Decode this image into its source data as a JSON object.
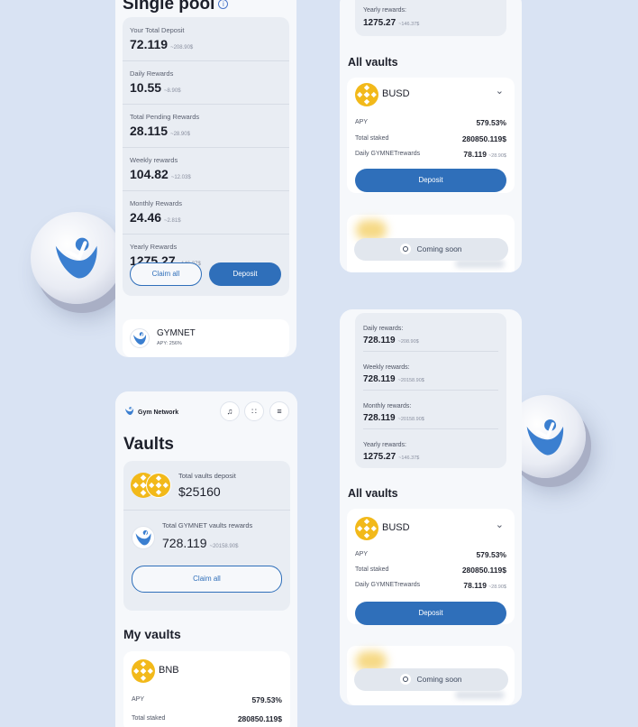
{
  "single_pool": {
    "title": "Single pool",
    "info_icon": "i",
    "stats": [
      {
        "label": "Your Total Deposit",
        "value": "72.119",
        "usd": "~208.90$"
      },
      {
        "label": "Daily Rewards",
        "value": "10.55",
        "usd": "~8.90$"
      },
      {
        "label": "Total Pending Rewards",
        "value": "28.115",
        "usd": "~28.90$"
      },
      {
        "label": "Weekly rewards",
        "value": "104.82",
        "usd": "~12.03$"
      },
      {
        "label": "Monthly Rewards",
        "value": "24.46",
        "usd": "~2.81$"
      },
      {
        "label": "Yearly Rewards",
        "value": "1275.27",
        "usd": "~146.37$"
      }
    ],
    "claim_label": "Claim all",
    "deposit_label": "Deposit",
    "pool_name": "GYMNET",
    "pool_apy": "APY: 256%"
  },
  "right_top": {
    "yearly_label": "Yearly rewards:",
    "yearly_value": "1275.27",
    "yearly_usd": "~146.37$",
    "section_title": "All vaults",
    "vault": {
      "name": "BUSD",
      "apy_label": "APY",
      "apy_value": "579.53%",
      "staked_label": "Total staked",
      "staked_value": "280850.119$",
      "daily_label": "Daily GYMNETrewards",
      "daily_value": "78.119",
      "daily_usd": "~28.90$",
      "deposit_label": "Deposit"
    },
    "coming_soon": "Coming soon"
  },
  "right_bottom": {
    "rewards": [
      {
        "label": "Daily rewards:",
        "value": "728.119",
        "usd": "~208.90$"
      },
      {
        "label": "Weekly rewards:",
        "value": "728.119",
        "usd": "~20158.90$"
      },
      {
        "label": "Monthly rewards:",
        "value": "728.119",
        "usd": "~20158.90$"
      },
      {
        "label": "Yearly rewards:",
        "value": "1275.27",
        "usd": "~146.37$"
      }
    ],
    "section_title": "All vaults",
    "vault": {
      "name": "BUSD",
      "apy_label": "APY",
      "apy_value": "579.53%",
      "staked_label": "Total staked",
      "staked_value": "280850.119$",
      "daily_label": "Daily GYMNETrewards",
      "daily_value": "78.119",
      "daily_usd": "~28.90$",
      "deposit_label": "Deposit"
    },
    "coming_soon": "Coming soon"
  },
  "vaults_page": {
    "brand": "Gym Network",
    "title": "Vaults",
    "total_deposit_label": "Total vaults deposit",
    "total_deposit_value": "$25160",
    "total_rewards_label": "Total GYMNET vaults rewards",
    "total_rewards_value": "728.119",
    "total_rewards_usd": "~20158.90$",
    "claim_label": "Claim all",
    "my_vaults_title": "My vaults",
    "my_vault": {
      "name": "BNB",
      "apy_label": "APY",
      "apy_value": "579.53%",
      "staked_label": "Total staked",
      "staked_value": "280850.119$"
    },
    "icons": [
      "bell-icon",
      "apps-icon",
      "menu-icon"
    ]
  },
  "colors": {
    "background": "#d9e3f3",
    "primary": "#2f6fba",
    "coin": "#f2b91a",
    "gym_blue": "#3b7fd0"
  }
}
